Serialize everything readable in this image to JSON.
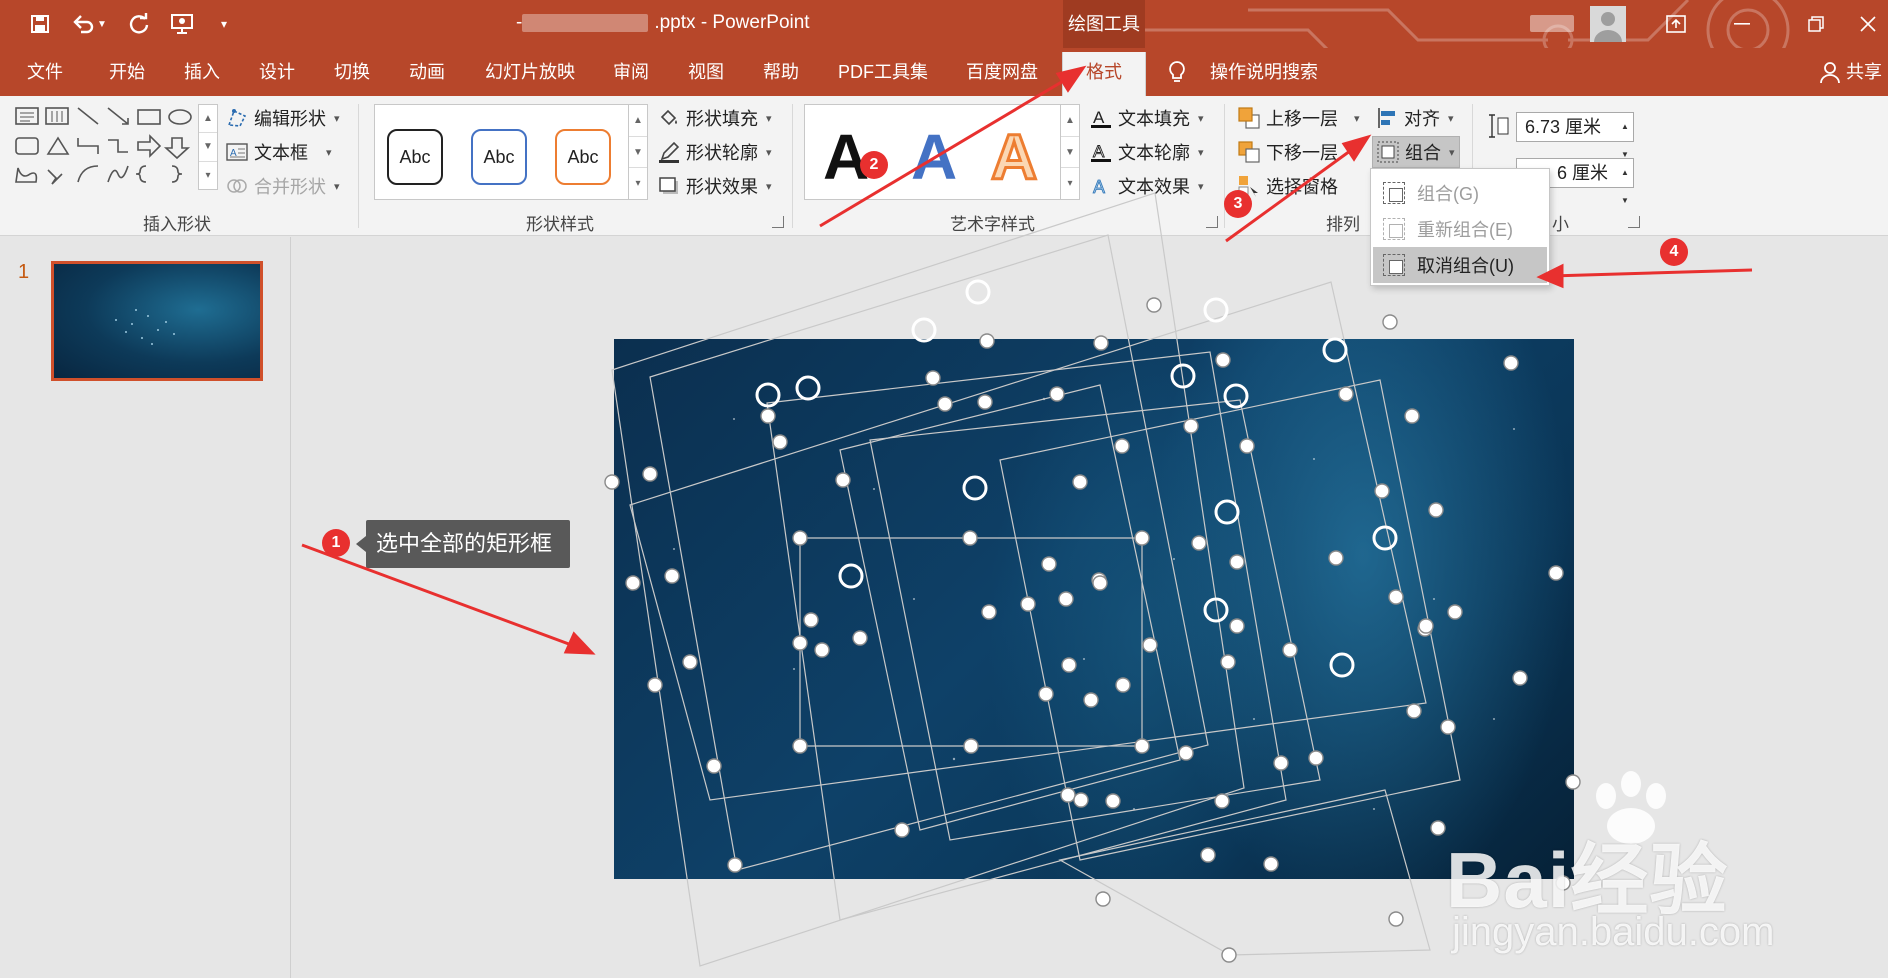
{
  "window": {
    "doc_title": "- PowerPoint",
    "doc_title_prefix": "-",
    "doc_title_ext": ".pptx",
    "contextual_tab_group": "绘图工具",
    "qat": {
      "save": "save-icon",
      "undo": "undo-icon",
      "redo": "redo-icon",
      "present": "present-icon",
      "customize": "customize-icon"
    }
  },
  "tabs": [
    {
      "label": "文件"
    },
    {
      "label": "开始"
    },
    {
      "label": "插入"
    },
    {
      "label": "设计"
    },
    {
      "label": "切换"
    },
    {
      "label": "动画"
    },
    {
      "label": "幻灯片放映"
    },
    {
      "label": "审阅"
    },
    {
      "label": "视图"
    },
    {
      "label": "帮助"
    },
    {
      "label": "PDF工具集"
    },
    {
      "label": "百度网盘"
    },
    {
      "label": "格式",
      "active": true
    }
  ],
  "tell_me": "操作说明搜索",
  "share": "共享",
  "ribbon": {
    "insert_shapes": {
      "label": "插入形状",
      "edit_shape": "编辑形状",
      "text_box": "文本框",
      "merge_shapes": "合并形状"
    },
    "shape_styles": {
      "label": "形状样式",
      "preset_text": "Abc",
      "shape_fill": "形状填充",
      "shape_outline": "形状轮廓",
      "shape_effects": "形状效果"
    },
    "wordart_styles": {
      "label": "艺术字样式",
      "letter": "A",
      "text_fill": "文本填充",
      "text_outline": "文本轮廓",
      "text_effects": "文本效果"
    },
    "arrange": {
      "label": "排列",
      "bring_forward": "上移一层",
      "send_backward": "下移一层",
      "selection_pane": "选择窗格",
      "align": "对齐",
      "group": "组合"
    },
    "size": {
      "label_partial": "小",
      "height": "6.73 厘米",
      "width_partial": "6 厘米"
    }
  },
  "group_menu": [
    {
      "label": "组合(G)",
      "enabled": false
    },
    {
      "label": "重新组合(E)",
      "enabled": false
    },
    {
      "label": "取消组合(U)",
      "enabled": true,
      "highlighted": true
    }
  ],
  "slides": {
    "current_number": "1"
  },
  "annotations": {
    "callout": "选中全部的矩形框",
    "badges": [
      "1",
      "2",
      "3",
      "4"
    ],
    "arrow_color": "#e8302f"
  },
  "watermark": {
    "brand": "Bai经验",
    "url": "jingyan.baidu.com"
  },
  "colors": {
    "accent": "#b7472a",
    "ribbon_bg": "#f3f3f3",
    "highlight": "#c6c6c6"
  }
}
